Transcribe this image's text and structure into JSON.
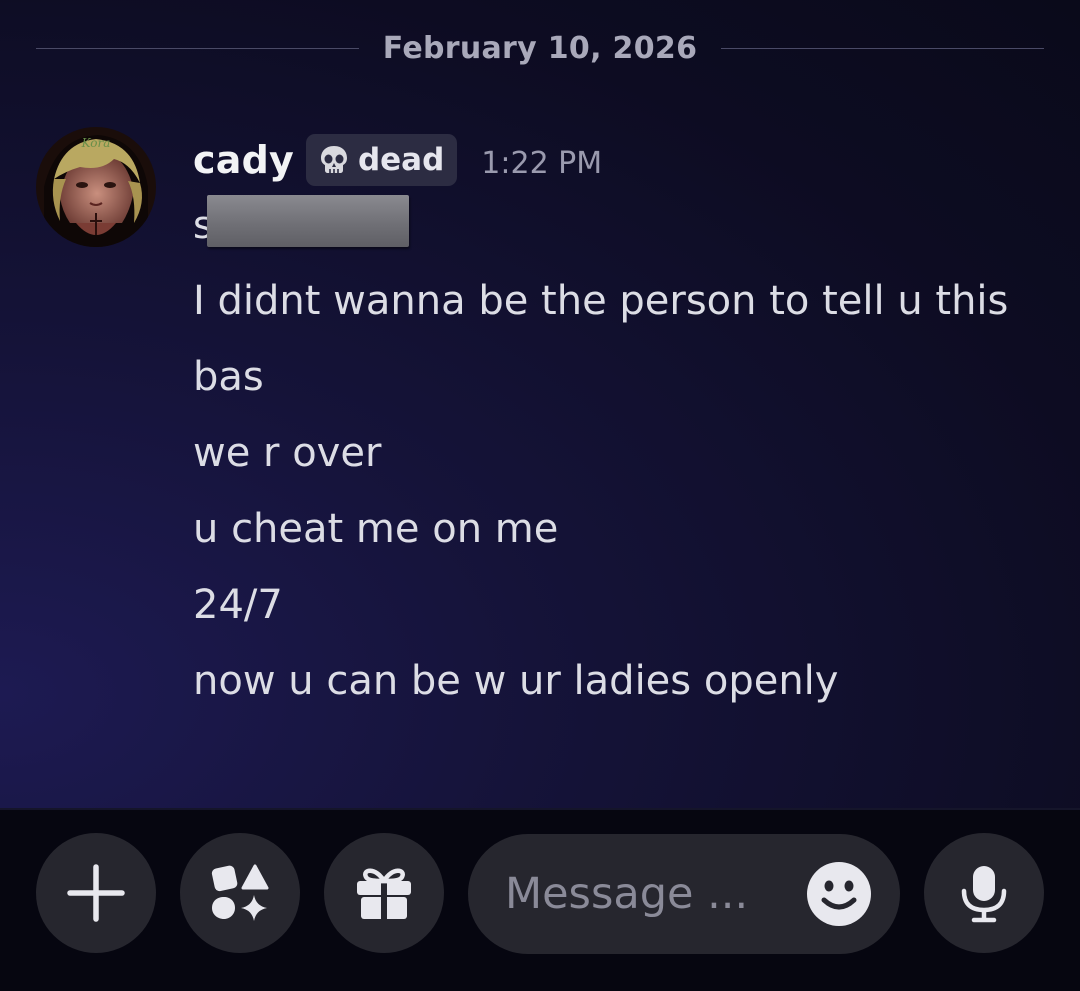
{
  "date_divider": "February 10, 2026",
  "message": {
    "author": "cady",
    "tag": {
      "icon": "skull-icon",
      "label": "dead"
    },
    "timestamp": "1:22 PM",
    "redacted_first_char": "s",
    "lines": [
      "I didnt wanna be the person to tell u this",
      "bas",
      "we r over",
      "u cheat me on me",
      "24/7",
      "now u can be w ur ladies openly"
    ]
  },
  "composer": {
    "placeholder": "Message ...",
    "buttons": [
      "plus-icon",
      "apps-icon",
      "gift-icon",
      "emoji-icon",
      "microphone-icon"
    ]
  },
  "colors": {
    "background": "#0d0c22",
    "bubble_button": "#26262e",
    "username": "#f2f3f5",
    "message_text": "#dcdde5"
  }
}
